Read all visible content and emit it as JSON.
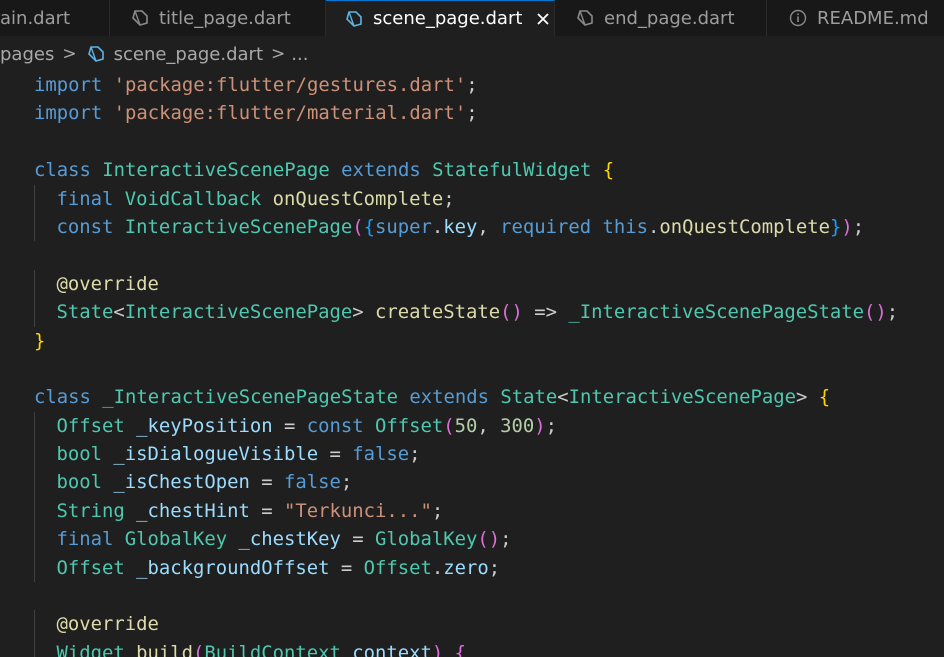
{
  "tabs": [
    {
      "label": "ain.dart",
      "active": false,
      "icon": "dart-file-icon"
    },
    {
      "label": "title_page.dart",
      "active": false,
      "icon": "dart-file-icon"
    },
    {
      "label": "scene_page.dart",
      "active": true,
      "icon": "dart-file-icon",
      "close": "×"
    },
    {
      "label": "end_page.dart",
      "active": false,
      "icon": "dart-file-icon"
    },
    {
      "label": "README.md",
      "active": false,
      "icon": "info-icon"
    }
  ],
  "breadcrumb": {
    "folder": "pages",
    "sep": ">",
    "file": "scene_page.dart",
    "ellipsis": "..."
  },
  "colors": {
    "keyword": "#569cd6",
    "control": "#c586c0",
    "type": "#4ec9b0",
    "string": "#ce9178",
    "function": "#dcdcaa",
    "variable": "#9cdcfe",
    "number": "#b5cea8",
    "text": "#cccccc",
    "bracket1": "#ffd700",
    "bracket2": "#da70d6",
    "bracket3": "#179fff",
    "accent": "#0078d4"
  },
  "code_lines": [
    {
      "indent": 1,
      "tokens": [
        {
          "t": "import",
          "c": "keyword"
        },
        {
          "t": " ",
          "c": "text"
        },
        {
          "t": "'package:flutter/gestures.dart'",
          "c": "string"
        },
        {
          "t": ";",
          "c": "text"
        }
      ]
    },
    {
      "indent": 1,
      "tokens": [
        {
          "t": "import",
          "c": "keyword"
        },
        {
          "t": " ",
          "c": "text"
        },
        {
          "t": "'package:flutter/material.dart'",
          "c": "string"
        },
        {
          "t": ";",
          "c": "text"
        }
      ]
    },
    {
      "indent": 0,
      "tokens": []
    },
    {
      "indent": 1,
      "tokens": [
        {
          "t": "class",
          "c": "keyword"
        },
        {
          "t": " ",
          "c": "text"
        },
        {
          "t": "InteractiveScenePage",
          "c": "type"
        },
        {
          "t": " ",
          "c": "text"
        },
        {
          "t": "extends",
          "c": "keyword"
        },
        {
          "t": " ",
          "c": "text"
        },
        {
          "t": "StatefulWidget",
          "c": "type"
        },
        {
          "t": " ",
          "c": "text"
        },
        {
          "t": "{",
          "c": "bracket1"
        }
      ]
    },
    {
      "indent": 2,
      "tokens": [
        {
          "t": "final",
          "c": "keyword"
        },
        {
          "t": " ",
          "c": "text"
        },
        {
          "t": "VoidCallback",
          "c": "type"
        },
        {
          "t": " ",
          "c": "text"
        },
        {
          "t": "onQuestComplete",
          "c": "function"
        },
        {
          "t": ";",
          "c": "text"
        }
      ]
    },
    {
      "indent": 2,
      "tokens": [
        {
          "t": "const",
          "c": "keyword"
        },
        {
          "t": " ",
          "c": "text"
        },
        {
          "t": "InteractiveScenePage",
          "c": "type"
        },
        {
          "t": "(",
          "c": "bracket2"
        },
        {
          "t": "{",
          "c": "bracket3"
        },
        {
          "t": "super",
          "c": "keyword"
        },
        {
          "t": ".",
          "c": "text"
        },
        {
          "t": "key",
          "c": "variable"
        },
        {
          "t": ", ",
          "c": "text"
        },
        {
          "t": "required",
          "c": "keyword"
        },
        {
          "t": " ",
          "c": "text"
        },
        {
          "t": "this",
          "c": "keyword"
        },
        {
          "t": ".",
          "c": "text"
        },
        {
          "t": "onQuestComplete",
          "c": "function"
        },
        {
          "t": "}",
          "c": "bracket3"
        },
        {
          "t": ")",
          "c": "bracket2"
        },
        {
          "t": ";",
          "c": "text"
        }
      ]
    },
    {
      "indent": 0,
      "tokens": []
    },
    {
      "indent": 2,
      "tokens": [
        {
          "t": "@override",
          "c": "function"
        }
      ]
    },
    {
      "indent": 2,
      "tokens": [
        {
          "t": "State",
          "c": "type"
        },
        {
          "t": "<",
          "c": "text"
        },
        {
          "t": "InteractiveScenePage",
          "c": "type"
        },
        {
          "t": ">",
          "c": "text"
        },
        {
          "t": " ",
          "c": "text"
        },
        {
          "t": "createState",
          "c": "function"
        },
        {
          "t": "()",
          "c": "bracket2"
        },
        {
          "t": " => ",
          "c": "text"
        },
        {
          "t": "_InteractiveScenePageState",
          "c": "type"
        },
        {
          "t": "()",
          "c": "bracket2"
        },
        {
          "t": ";",
          "c": "text"
        }
      ]
    },
    {
      "indent": 1,
      "tokens": [
        {
          "t": "}",
          "c": "bracket1"
        }
      ]
    },
    {
      "indent": 0,
      "tokens": []
    },
    {
      "indent": 1,
      "tokens": [
        {
          "t": "class",
          "c": "keyword"
        },
        {
          "t": " ",
          "c": "text"
        },
        {
          "t": "_InteractiveScenePageState",
          "c": "type"
        },
        {
          "t": " ",
          "c": "text"
        },
        {
          "t": "extends",
          "c": "keyword"
        },
        {
          "t": " ",
          "c": "text"
        },
        {
          "t": "State",
          "c": "type"
        },
        {
          "t": "<",
          "c": "text"
        },
        {
          "t": "InteractiveScenePage",
          "c": "type"
        },
        {
          "t": ">",
          "c": "text"
        },
        {
          "t": " ",
          "c": "text"
        },
        {
          "t": "{",
          "c": "bracket1"
        }
      ]
    },
    {
      "indent": 2,
      "tokens": [
        {
          "t": "Offset",
          "c": "type"
        },
        {
          "t": " ",
          "c": "text"
        },
        {
          "t": "_keyPosition",
          "c": "variable"
        },
        {
          "t": " = ",
          "c": "text"
        },
        {
          "t": "const",
          "c": "keyword"
        },
        {
          "t": " ",
          "c": "text"
        },
        {
          "t": "Offset",
          "c": "type"
        },
        {
          "t": "(",
          "c": "bracket2"
        },
        {
          "t": "50",
          "c": "number"
        },
        {
          "t": ", ",
          "c": "text"
        },
        {
          "t": "300",
          "c": "number"
        },
        {
          "t": ")",
          "c": "bracket2"
        },
        {
          "t": ";",
          "c": "text"
        }
      ]
    },
    {
      "indent": 2,
      "tokens": [
        {
          "t": "bool",
          "c": "type"
        },
        {
          "t": " ",
          "c": "text"
        },
        {
          "t": "_isDialogueVisible",
          "c": "variable"
        },
        {
          "t": " = ",
          "c": "text"
        },
        {
          "t": "false",
          "c": "keyword"
        },
        {
          "t": ";",
          "c": "text"
        }
      ]
    },
    {
      "indent": 2,
      "tokens": [
        {
          "t": "bool",
          "c": "type"
        },
        {
          "t": " ",
          "c": "text"
        },
        {
          "t": "_isChestOpen",
          "c": "variable"
        },
        {
          "t": " = ",
          "c": "text"
        },
        {
          "t": "false",
          "c": "keyword"
        },
        {
          "t": ";",
          "c": "text"
        }
      ]
    },
    {
      "indent": 2,
      "tokens": [
        {
          "t": "String",
          "c": "type"
        },
        {
          "t": " ",
          "c": "text"
        },
        {
          "t": "_chestHint",
          "c": "variable"
        },
        {
          "t": " = ",
          "c": "text"
        },
        {
          "t": "\"Terkunci...\"",
          "c": "string"
        },
        {
          "t": ";",
          "c": "text"
        }
      ]
    },
    {
      "indent": 2,
      "tokens": [
        {
          "t": "final",
          "c": "keyword"
        },
        {
          "t": " ",
          "c": "text"
        },
        {
          "t": "GlobalKey",
          "c": "type"
        },
        {
          "t": " ",
          "c": "text"
        },
        {
          "t": "_chestKey",
          "c": "variable"
        },
        {
          "t": " = ",
          "c": "text"
        },
        {
          "t": "GlobalKey",
          "c": "type"
        },
        {
          "t": "()",
          "c": "bracket2"
        },
        {
          "t": ";",
          "c": "text"
        }
      ]
    },
    {
      "indent": 2,
      "tokens": [
        {
          "t": "Offset",
          "c": "type"
        },
        {
          "t": " ",
          "c": "text"
        },
        {
          "t": "_backgroundOffset",
          "c": "variable"
        },
        {
          "t": " = ",
          "c": "text"
        },
        {
          "t": "Offset",
          "c": "type"
        },
        {
          "t": ".",
          "c": "text"
        },
        {
          "t": "zero",
          "c": "variable"
        },
        {
          "t": ";",
          "c": "text"
        }
      ]
    },
    {
      "indent": 0,
      "tokens": []
    },
    {
      "indent": 2,
      "tokens": [
        {
          "t": "@override",
          "c": "function"
        }
      ]
    },
    {
      "indent": 2,
      "tokens": [
        {
          "t": "Widget",
          "c": "type"
        },
        {
          "t": " ",
          "c": "text"
        },
        {
          "t": "build",
          "c": "function"
        },
        {
          "t": "(",
          "c": "bracket2"
        },
        {
          "t": "BuildContext",
          "c": "type"
        },
        {
          "t": " ",
          "c": "text"
        },
        {
          "t": "context",
          "c": "variable"
        },
        {
          "t": ")",
          "c": "bracket2"
        },
        {
          "t": " ",
          "c": "text"
        },
        {
          "t": "{",
          "c": "bracket2"
        }
      ]
    }
  ]
}
